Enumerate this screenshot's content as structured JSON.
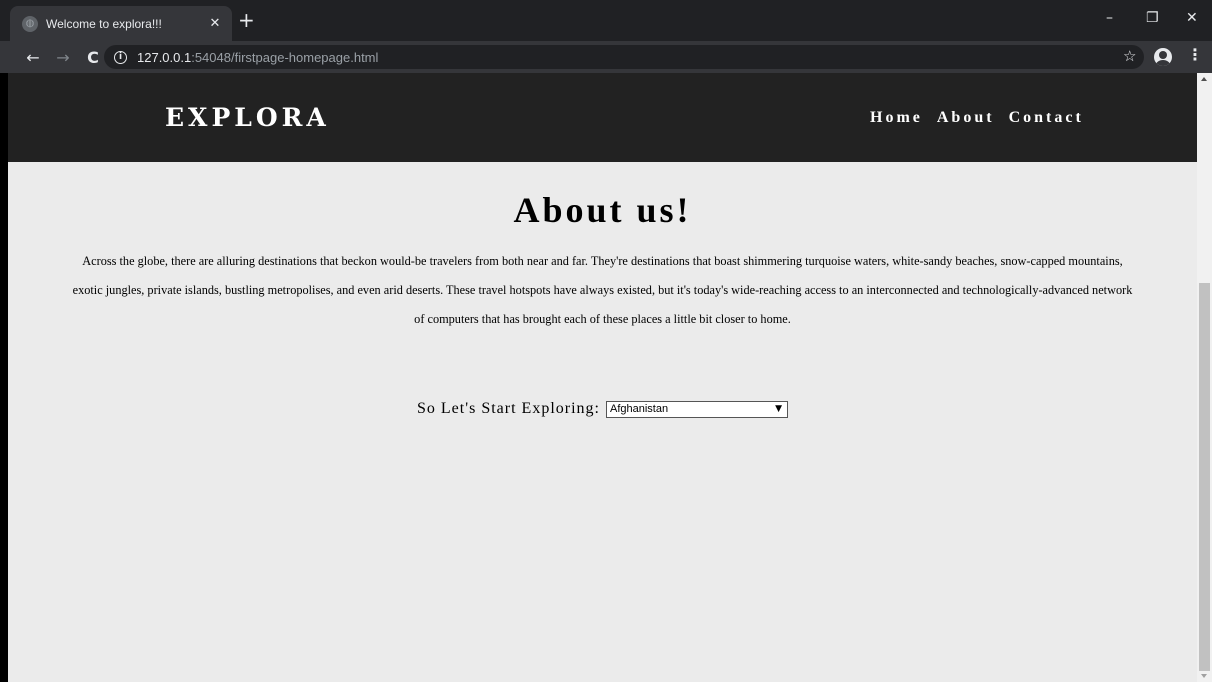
{
  "browser": {
    "tab_title": "Welcome to explora!!!",
    "tab_close": "✕",
    "new_tab": "+",
    "url_host": "127.0.0.1",
    "url_rest": ":54048/firstpage-homepage.html",
    "window_controls": {
      "minimize": "–",
      "restore": "❐",
      "close": "✕"
    },
    "nav": {
      "back": "←",
      "forward": "→",
      "reload": "C"
    },
    "icons": {
      "info": "i",
      "star": "☆",
      "menu": "⋮"
    }
  },
  "site": {
    "logo": "EXPLORA",
    "nav": [
      {
        "label": "Home"
      },
      {
        "label": "About"
      },
      {
        "label": "Contact"
      }
    ],
    "about_title": "About us!",
    "about_text": "Across the globe, there are alluring destinations that beckon would-be travelers from both near and far. They're destinations that boast shimmering turquoise waters, white-sandy beaches, snow-capped mountains, exotic jungles, private islands, bustling metropolises, and even arid deserts. These travel hotspots have always existed, but it's today's wide-reaching access to an interconnected and technologically-advanced network of computers that has brought each of these places a little bit closer to home.",
    "explore_label": "So Let's Start Exploring:",
    "country_select": {
      "selected": "Afghanistan"
    }
  }
}
